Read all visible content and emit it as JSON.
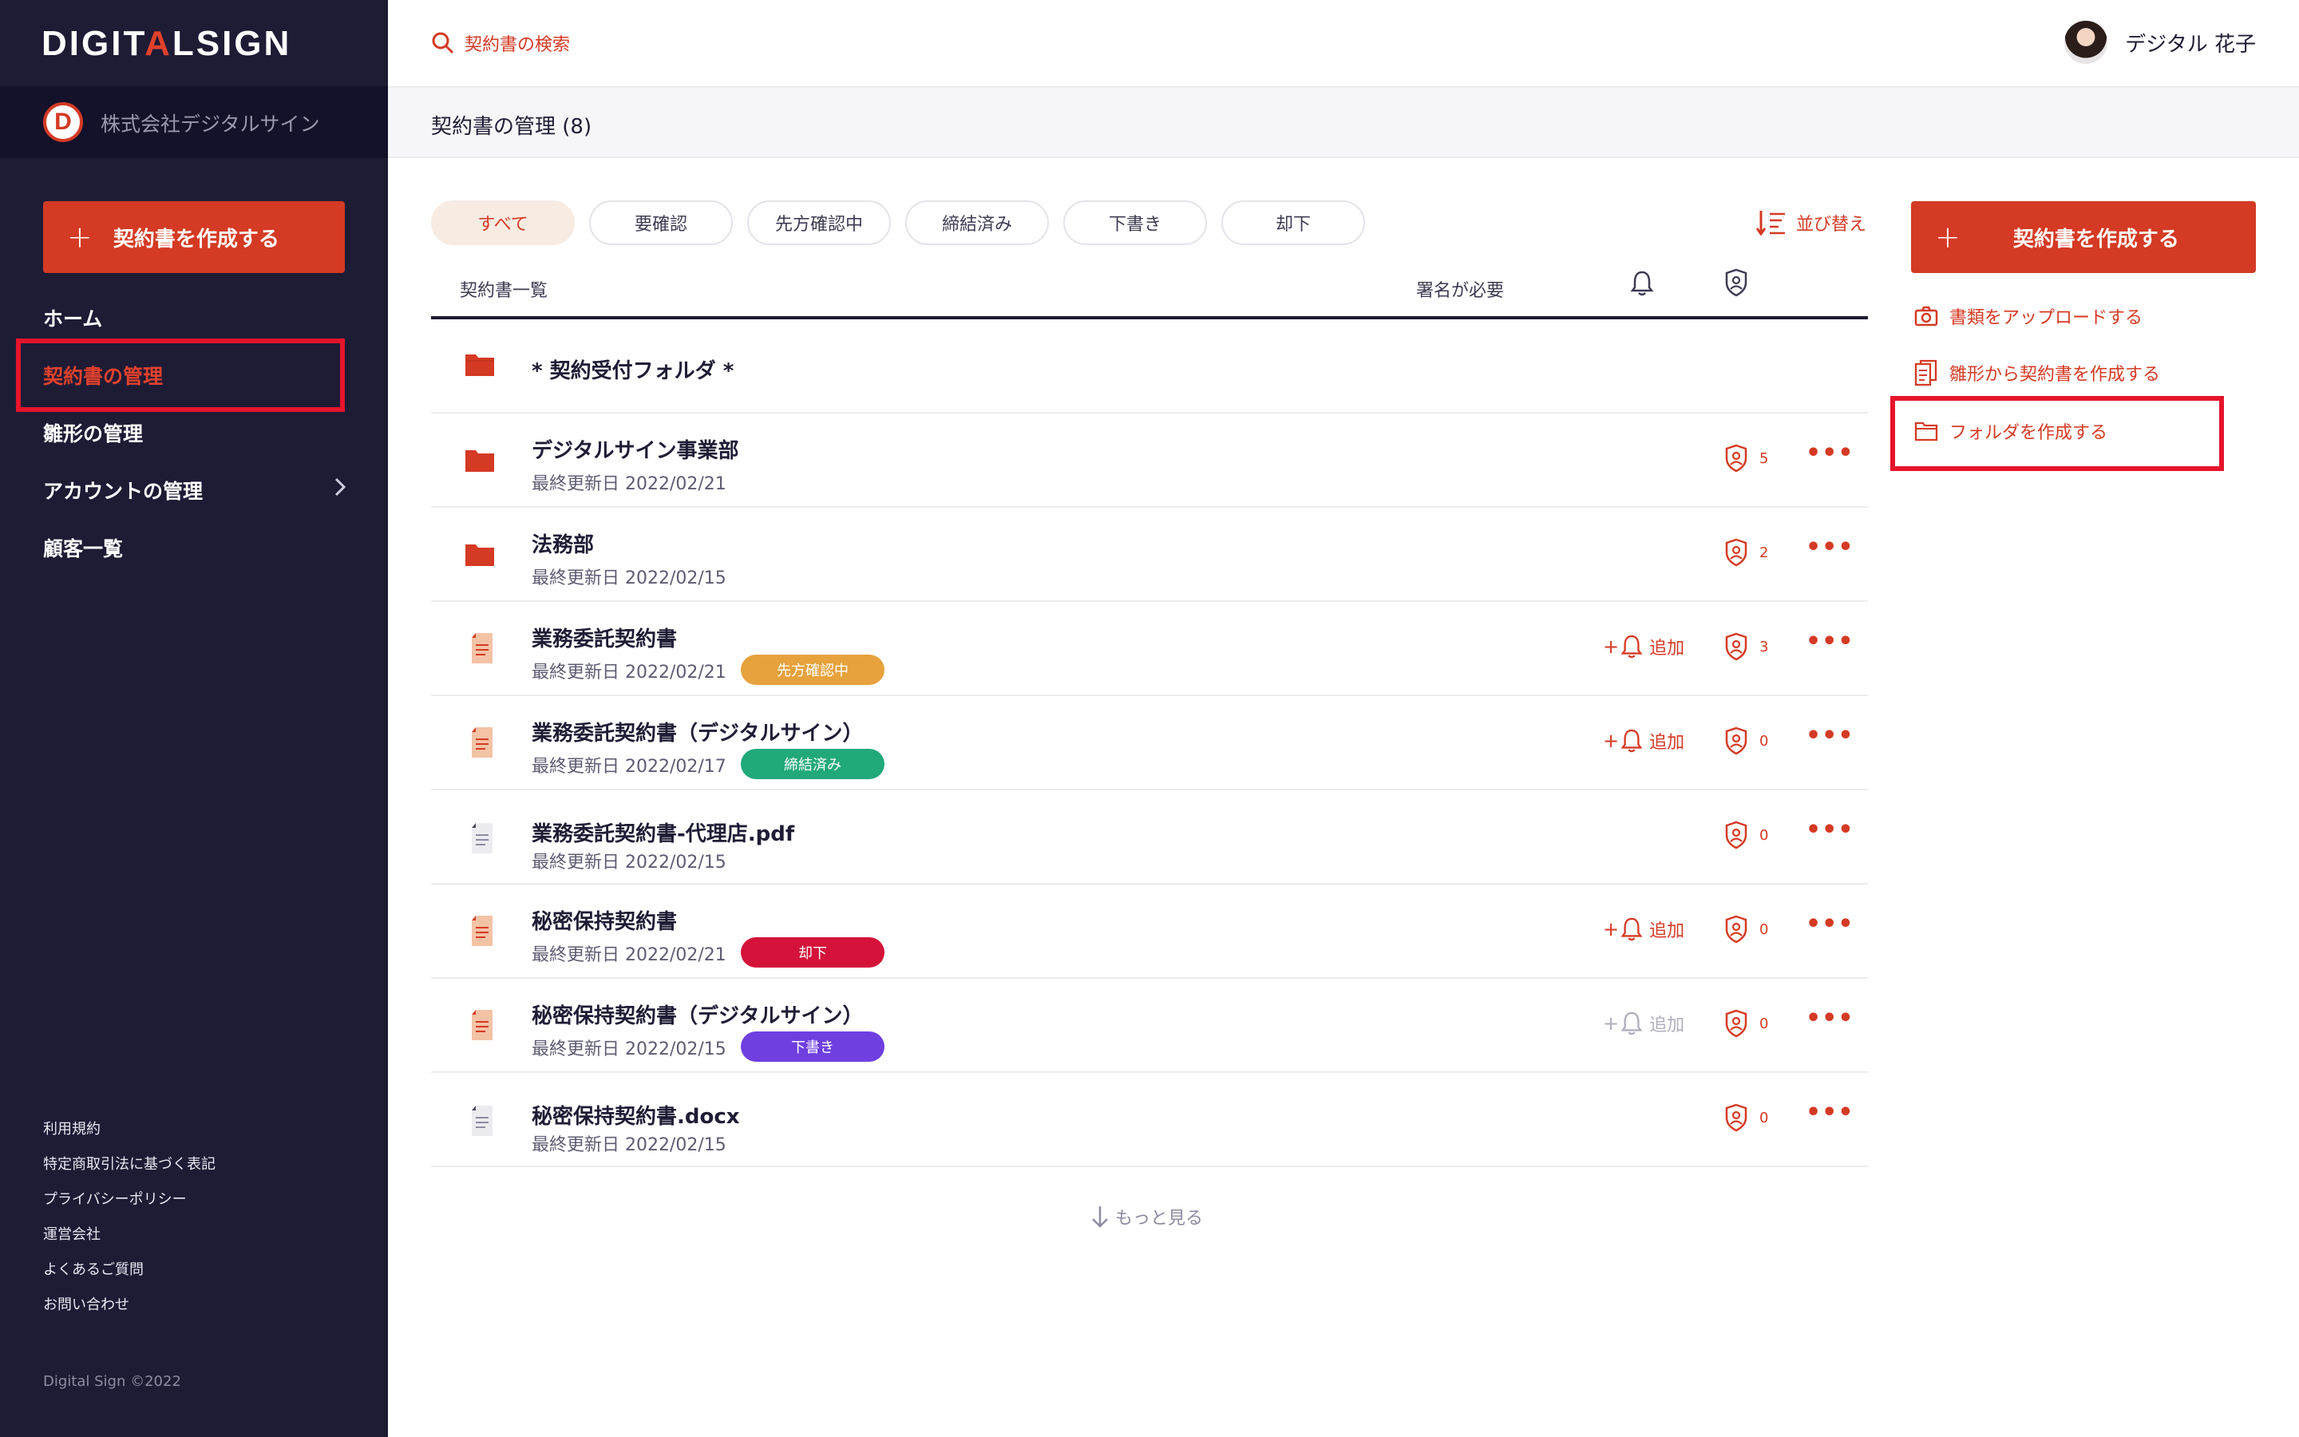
{
  "sidebar": {
    "logo_part1": "DIGIT",
    "logo_accent": "A",
    "logo_part2": "LSIGN",
    "org_initial": "D",
    "org_name": "株式会社デジタルサイン",
    "create_label": "契約書を作成する",
    "nav": [
      {
        "label": "ホーム"
      },
      {
        "label": "契約書の管理"
      },
      {
        "label": "雛形の管理"
      },
      {
        "label": "アカウントの管理"
      },
      {
        "label": "顧客一覧"
      }
    ],
    "footer_links": [
      "利用規約",
      "特定商取引法に基づく表記",
      "プライバシーポリシー",
      "運営会社",
      "よくあるご質問",
      "お問い合わせ"
    ],
    "copyright": "Digital Sign ©2022"
  },
  "header": {
    "search_placeholder": "契約書の検索",
    "user_name": "デジタル 花子"
  },
  "subheader": {
    "title": "契約書の管理 (8)"
  },
  "filters": [
    "すべて",
    "要確認",
    "先方確認中",
    "締結済み",
    "下書き",
    "却下"
  ],
  "sort_label": "並び替え",
  "table": {
    "col_list": "契約書一覧",
    "col_sign": "署名が必要",
    "rows": [
      {
        "title": "* 契約受付フォルダ *",
        "type": "folder"
      },
      {
        "title": "デジタルサイン事業部",
        "date": "最終更新日 2022/02/21",
        "type": "folder",
        "count": "5"
      },
      {
        "title": "法務部",
        "date": "最終更新日 2022/02/15",
        "type": "folder",
        "count": "2"
      },
      {
        "title": "業務委託契約書",
        "date": "最終更新日 2022/02/21",
        "type": "contract",
        "badge": "先方確認中",
        "badge_color": "#e6a23c",
        "alert": "追加",
        "count": "3"
      },
      {
        "title": "業務委託契約書（デジタルサイン）",
        "date": "最終更新日 2022/02/17",
        "type": "contract",
        "badge": "締結済み",
        "badge_color": "#21a97a",
        "alert": "追加",
        "count": "0"
      },
      {
        "title": "業務委託契約書-代理店.pdf",
        "date": "最終更新日 2022/02/15",
        "type": "file",
        "count": "0"
      },
      {
        "title": "秘密保持契約書",
        "date": "最終更新日 2022/02/21",
        "type": "contract",
        "badge": "却下",
        "badge_color": "#d4123a",
        "alert": "追加",
        "count": "0"
      },
      {
        "title": "秘密保持契約書（デジタルサイン）",
        "date": "最終更新日 2022/02/15",
        "type": "contract",
        "badge": "下書き",
        "badge_color": "#6f3fe0",
        "alert": "追加",
        "count": "0"
      },
      {
        "title": "秘密保持契約書.docx",
        "date": "最終更新日 2022/02/15",
        "type": "file",
        "count": "0"
      }
    ],
    "more_label": "もっと見る"
  },
  "right_panel": {
    "create_label": "契約書を作成する",
    "upload_label": "書類をアップロードする",
    "template_label": "雛形から契約書を作成する",
    "folder_label": "フォルダを作成する"
  },
  "colors": {
    "accent": "#d43a24",
    "sidebar_bg": "#1e1b35",
    "highlight": "#e5142b"
  }
}
